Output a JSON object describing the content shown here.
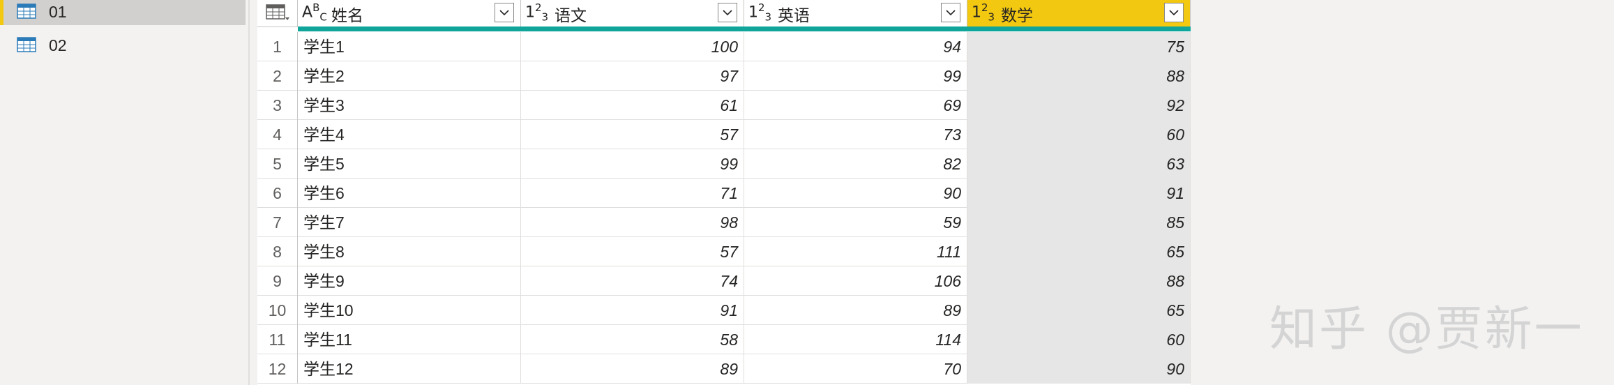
{
  "queries": [
    {
      "name": "01",
      "selected": true
    },
    {
      "name": "02",
      "selected": false
    }
  ],
  "grid": {
    "columns": [
      {
        "name": "姓名",
        "type_icon": "text-type-icon"
      },
      {
        "name": "语文",
        "type_icon": "whole-number-type-icon"
      },
      {
        "name": "英语",
        "type_icon": "whole-number-type-icon"
      },
      {
        "name": "数学",
        "type_icon": "whole-number-type-icon",
        "selected": true
      }
    ],
    "rows": [
      {
        "n": "1",
        "name": "学生1",
        "yuwen": "100",
        "yingyu": "94",
        "shuxue": "75"
      },
      {
        "n": "2",
        "name": "学生2",
        "yuwen": "97",
        "yingyu": "99",
        "shuxue": "88"
      },
      {
        "n": "3",
        "name": "学生3",
        "yuwen": "61",
        "yingyu": "69",
        "shuxue": "92"
      },
      {
        "n": "4",
        "name": "学生4",
        "yuwen": "57",
        "yingyu": "73",
        "shuxue": "60"
      },
      {
        "n": "5",
        "name": "学生5",
        "yuwen": "99",
        "yingyu": "82",
        "shuxue": "63"
      },
      {
        "n": "6",
        "name": "学生6",
        "yuwen": "71",
        "yingyu": "90",
        "shuxue": "91"
      },
      {
        "n": "7",
        "name": "学生7",
        "yuwen": "98",
        "yingyu": "59",
        "shuxue": "85"
      },
      {
        "n": "8",
        "name": "学生8",
        "yuwen": "57",
        "yingyu": "111",
        "shuxue": "65"
      },
      {
        "n": "9",
        "name": "学生9",
        "yuwen": "74",
        "yingyu": "106",
        "shuxue": "88"
      },
      {
        "n": "10",
        "name": "学生10",
        "yuwen": "91",
        "yingyu": "89",
        "shuxue": "65"
      },
      {
        "n": "11",
        "name": "学生11",
        "yuwen": "58",
        "yingyu": "114",
        "shuxue": "60"
      },
      {
        "n": "12",
        "name": "学生12",
        "yuwen": "89",
        "yingyu": "70",
        "shuxue": "90"
      }
    ]
  },
  "colors": {
    "selected_column": "#f2c811",
    "quality_bar": "#0fa59b",
    "selected_query_accent": "#f2c811"
  },
  "watermark": "知乎 @贾新一"
}
